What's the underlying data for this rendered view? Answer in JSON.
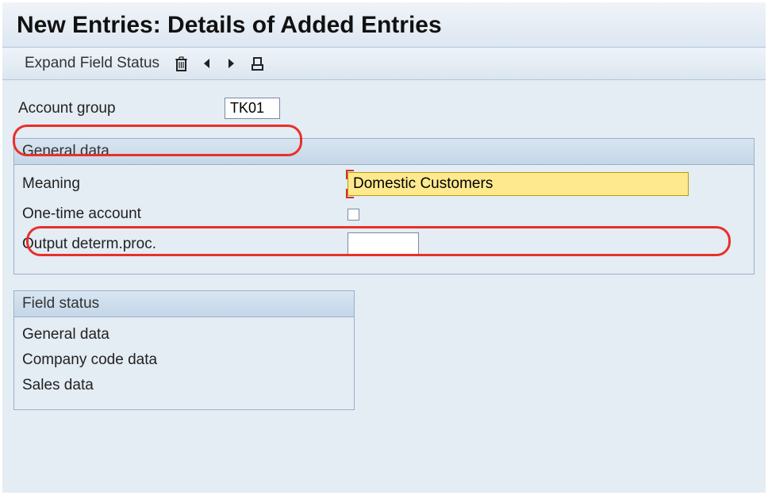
{
  "title": "New Entries: Details of Added Entries",
  "toolbar": {
    "expand_label": "Expand Field Status"
  },
  "fields": {
    "account_group_label": "Account group",
    "account_group_value": "TK01"
  },
  "general_panel": {
    "title": "General data",
    "meaning_label": "Meaning",
    "meaning_value": "Domestic Customers",
    "onetime_label": "One-time account",
    "output_label": "Output determ.proc.",
    "output_value": ""
  },
  "status_panel": {
    "title": "Field status",
    "items": [
      "General data",
      "Company code data",
      "Sales data"
    ]
  }
}
